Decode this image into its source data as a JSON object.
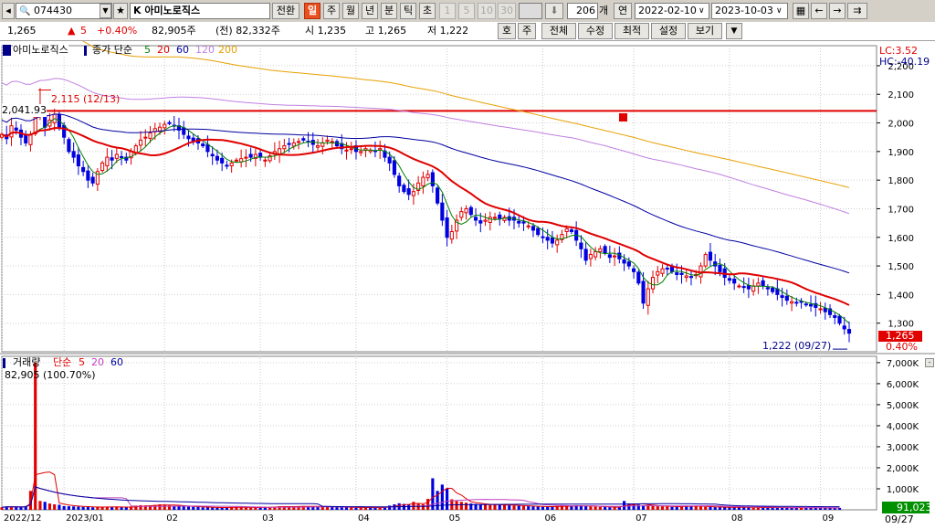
{
  "toolbar": {
    "code": "074430",
    "name": "K 아미노로직스",
    "convert_label": "전환",
    "period_tabs": [
      "일",
      "주",
      "월",
      "년",
      "분",
      "틱",
      "초"
    ],
    "selected_period": "일",
    "interval_buttons": [
      "1",
      "5",
      "10",
      "30"
    ],
    "count": "206",
    "count_unit": "개",
    "date_mode": "연",
    "start_date": "2022-02-10",
    "end_date": "2023-10-03"
  },
  "infobar": {
    "price": "1,265",
    "change_arrow": "▲",
    "change": "5",
    "change_pct": "+0.40%",
    "volume": "82,905주",
    "prev_volume": "(전) 82,332주",
    "open": "시 1,235",
    "high": "고 1,265",
    "low": "저 1,222",
    "quote_buttons": [
      "호",
      "주"
    ],
    "menu_buttons": [
      "전체",
      "수정",
      "최적",
      "설정",
      "보기"
    ]
  },
  "chart_data": [
    {
      "type": "candlestick",
      "legend_name": "아미노로직스",
      "ma_legend": {
        "label": "종가 단순",
        "periods": [
          "5",
          "20",
          "60",
          "120",
          "200"
        ],
        "colors": [
          "#008000",
          "#e00000",
          "#0000a0",
          "#c080e0",
          "#e8a000"
        ]
      },
      "ylim": [
        1200,
        2270
      ],
      "y_ticks": [
        "2,200",
        "2,100",
        "2,000",
        "1,900",
        "1,800",
        "1,700",
        "1,600",
        "1,500",
        "1,400",
        "1,300"
      ],
      "x_ticks": [
        "2022/12",
        "2023/01",
        "02",
        "03",
        "04",
        "05",
        "06",
        "07",
        "08",
        "09"
      ],
      "x_tick_index": [
        0,
        13,
        34,
        54,
        74,
        93,
        113,
        132,
        152,
        171
      ],
      "lc_label": "LC:3.52",
      "hc_label": "HC:-40.19",
      "last_price_label": "1,265",
      "last_pct_label": "0.40%",
      "high_annotation": "2,115 (12/13)",
      "low_annotation": "1,222 (09/27)",
      "hline_value": 2041.93,
      "hline_label": "2,041.93",
      "close": [
        1960,
        1945,
        1990,
        1975,
        1950,
        1930,
        1960,
        2020,
        2030,
        1985,
        2010,
        2030,
        1985,
        1950,
        1900,
        1880,
        1850,
        1830,
        1800,
        1790,
        1830,
        1860,
        1880,
        1870,
        1890,
        1880,
        1870,
        1900,
        1920,
        1940,
        1950,
        1965,
        1980,
        1985,
        1995,
        2000,
        1990,
        1975,
        1960,
        1945,
        1935,
        1930,
        1920,
        1900,
        1885,
        1870,
        1860,
        1850,
        1860,
        1870,
        1875,
        1880,
        1880,
        1890,
        1880,
        1870,
        1885,
        1900,
        1910,
        1920,
        1925,
        1930,
        1935,
        1940,
        1935,
        1925,
        1920,
        1930,
        1940,
        1935,
        1920,
        1910,
        1905,
        1910,
        1900,
        1900,
        1910,
        1905,
        1900,
        1910,
        1880,
        1860,
        1820,
        1780,
        1760,
        1750,
        1760,
        1790,
        1810,
        1820,
        1780,
        1720,
        1660,
        1600,
        1620,
        1660,
        1690,
        1700,
        1680,
        1660,
        1650,
        1660,
        1670,
        1670,
        1665,
        1670,
        1660,
        1660,
        1650,
        1650,
        1640,
        1625,
        1610,
        1600,
        1590,
        1580,
        1590,
        1610,
        1630,
        1620,
        1590,
        1560,
        1520,
        1540,
        1550,
        1560,
        1545,
        1530,
        1535,
        1525,
        1510,
        1500,
        1480,
        1440,
        1370,
        1420,
        1460,
        1480,
        1490,
        1490,
        1480,
        1470,
        1470,
        1465,
        1460,
        1470,
        1500,
        1540,
        1520,
        1500,
        1480,
        1460,
        1450,
        1440,
        1430,
        1425,
        1420,
        1430,
        1440,
        1430,
        1420,
        1410,
        1400,
        1390,
        1380,
        1375,
        1370,
        1375,
        1365,
        1360,
        1355,
        1350,
        1340,
        1330,
        1320,
        1300,
        1280,
        1265
      ],
      "volume": {
        "label": "거래량",
        "ma_label": "단순",
        "ma_periods": [
          "5",
          "20",
          "60"
        ],
        "current_label": "82,905 (100.70%)",
        "y_ticks": [
          "7,000K",
          "6,000K",
          "5,000K",
          "4,000K",
          "3,000K",
          "2,000K",
          "1,000K"
        ],
        "ylim": [
          0,
          7300
        ],
        "last_volume_label": "91,023",
        "date_label": "09/27",
        "values": [
          120,
          160,
          150,
          130,
          110,
          180,
          900,
          7000,
          420,
          380,
          300,
          260,
          240,
          180,
          170,
          160,
          150,
          140,
          130,
          120,
          130,
          140,
          150,
          140,
          130,
          120,
          110,
          160,
          200,
          220,
          210,
          190,
          230,
          260,
          250,
          210,
          190,
          170,
          160,
          150,
          140,
          130,
          120,
          110,
          105,
          100,
          110,
          120,
          130,
          120,
          110,
          100,
          95,
          110,
          120,
          140,
          130,
          150,
          170,
          160,
          150,
          140,
          170,
          180,
          160,
          150,
          140,
          160,
          150,
          140,
          130,
          120,
          110,
          105,
          100,
          110,
          120,
          100,
          90,
          110,
          150,
          200,
          260,
          310,
          280,
          240,
          380,
          320,
          260,
          520,
          1500,
          900,
          1200,
          1000,
          500,
          420,
          380,
          340,
          300,
          280,
          260,
          240,
          230,
          250,
          240,
          220,
          210,
          200,
          190,
          180,
          170,
          160,
          150,
          140,
          150,
          160,
          180,
          200,
          170,
          160,
          220,
          200,
          180,
          160,
          150,
          140,
          130,
          120,
          110,
          130,
          420,
          300,
          260,
          240,
          220,
          200,
          180,
          170,
          160,
          150,
          140,
          150,
          170,
          200,
          180,
          160,
          150,
          140,
          130,
          125,
          120,
          115,
          110,
          120,
          130,
          120,
          110,
          100,
          100,
          110,
          120,
          110,
          100,
          95,
          90,
          100,
          110,
          105,
          100,
          95,
          90,
          85,
          90,
          100,
          95,
          91
        ]
      }
    }
  ]
}
